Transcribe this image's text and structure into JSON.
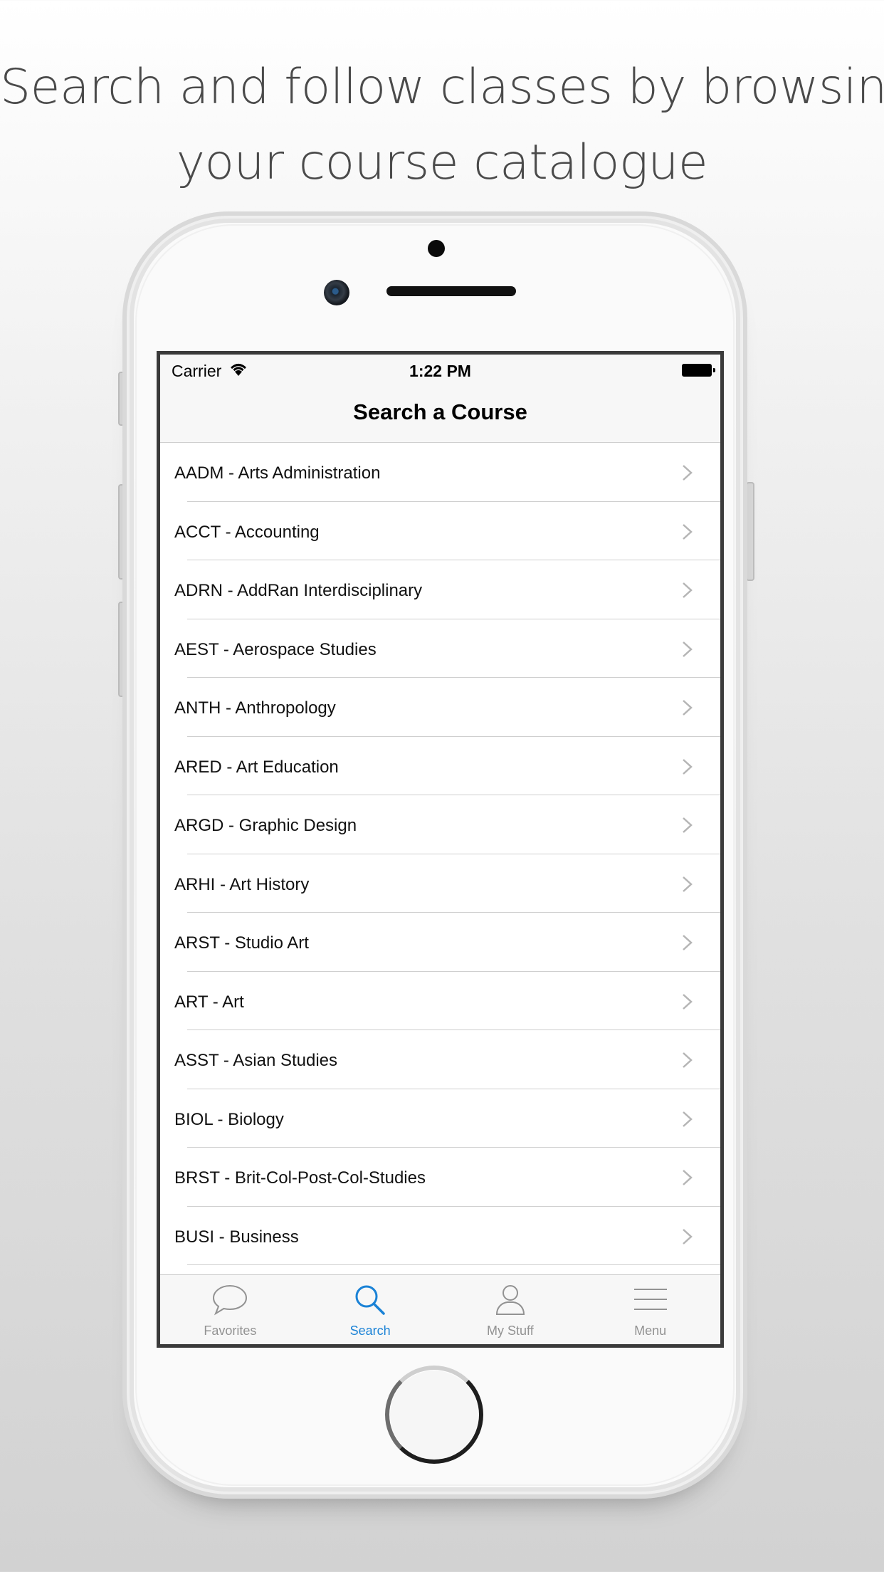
{
  "headline": {
    "line1": "Search and follow classes by browsing",
    "line2": "your course catalogue"
  },
  "status_bar": {
    "carrier": "Carrier",
    "time": "1:22 PM"
  },
  "nav": {
    "title": "Search a Course"
  },
  "courses": [
    {
      "label": "AADM - Arts Administration"
    },
    {
      "label": "ACCT - Accounting"
    },
    {
      "label": "ADRN - AddRan Interdisciplinary"
    },
    {
      "label": "AEST - Aerospace Studies"
    },
    {
      "label": "ANTH - Anthropology"
    },
    {
      "label": "ARED - Art Education"
    },
    {
      "label": "ARGD - Graphic Design"
    },
    {
      "label": "ARHI - Art History"
    },
    {
      "label": "ARST - Studio Art"
    },
    {
      "label": "ART - Art"
    },
    {
      "label": "ASST - Asian Studies"
    },
    {
      "label": "BIOL - Biology"
    },
    {
      "label": "BRST - Brit-Col-Post-Col-Studies"
    },
    {
      "label": "BUSI - Business"
    }
  ],
  "tabs": [
    {
      "label": "Favorites",
      "icon": "speech-bubble-icon",
      "active": false
    },
    {
      "label": "Search",
      "icon": "search-icon",
      "active": true
    },
    {
      "label": "My Stuff",
      "icon": "person-icon",
      "active": false
    },
    {
      "label": "Menu",
      "icon": "menu-icon",
      "active": false
    }
  ],
  "colors": {
    "accent": "#1a82d6",
    "inactive_tab": "#929292",
    "headline": "#4a4a4a"
  }
}
